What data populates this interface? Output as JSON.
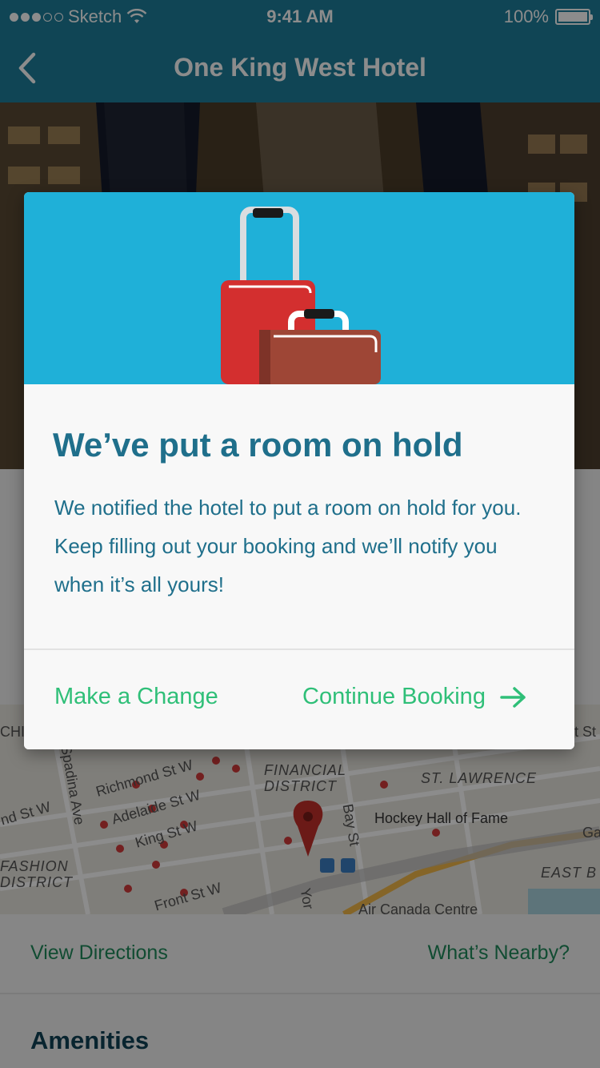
{
  "status_bar": {
    "carrier": "Sketch",
    "time": "9:41 AM",
    "battery": "100%"
  },
  "nav": {
    "title": "One King West Hotel",
    "back_icon": "chevron-left-icon"
  },
  "page": {
    "map_labels": [
      "Richmond St W",
      "Adelaide St W",
      "King St W",
      "Front St W",
      "Spadina Ave",
      "FINANCIAL DISTRICT",
      "ST. LAWRENCE",
      "Hockey Hall of Fame",
      "FASHION DISTRICT",
      "Bay St",
      "Air Canada Centre",
      "EAST B",
      "nd St W",
      "Yor",
      "Ga",
      "CHI",
      "t St"
    ],
    "view_directions": "View Directions",
    "whats_nearby": "What’s Nearby?",
    "amenities_heading": "Amenities"
  },
  "modal": {
    "illustration_icon": "luggage-icon",
    "title": "We’ve put a room on hold",
    "message": "We notified the hotel to put a room on hold for you. Keep filling out your booking and we’ll notify you when it’s all yours!",
    "make_change_label": "Make a Change",
    "continue_label": "Continue Booking",
    "continue_icon": "arrow-right-icon"
  },
  "colors": {
    "nav_bg": "#1e7f9b",
    "modal_art_bg": "#1fb0d8",
    "title_text": "#1f6f8b",
    "action_green": "#2fbf78",
    "link_green": "#1f8a5c"
  }
}
